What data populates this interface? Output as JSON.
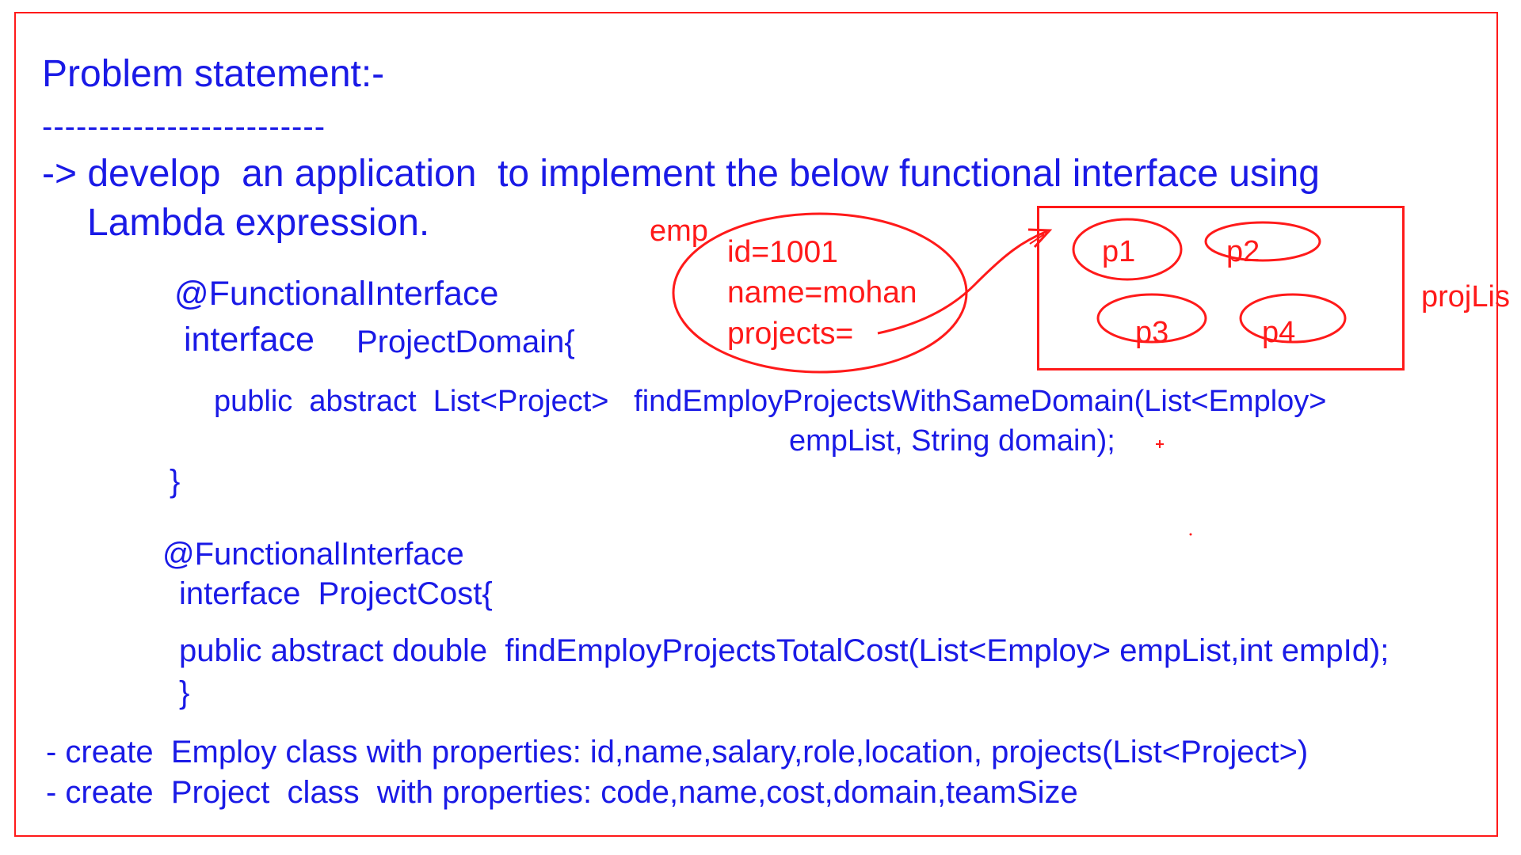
{
  "colors": {
    "text": "#1a1ae6",
    "annotation": "#ff1a1a",
    "background": "#ffffff"
  },
  "heading": {
    "title": "Problem statement:-",
    "underline": "-------------------------"
  },
  "intro": {
    "line1": "-> develop  an application  to implement the below functional interface using",
    "line2": "Lambda expression."
  },
  "interface1": {
    "annotation": "@FunctionalInterface",
    "keyword": "interface",
    "name": "ProjectDomain{",
    "method_line1": "public  abstract  List<Project>   findEmployProjectsWithSameDomain(List<Employ>",
    "method_line2": "empList, String domain);",
    "closing": "}"
  },
  "interface2": {
    "annotation": "@FunctionalInterface",
    "declaration": "interface  ProjectCost{",
    "method": "public abstract double  findEmployProjectsTotalCost(List<Employ> empList,int empId);",
    "closing": "}"
  },
  "requirements": [
    "- create  Employ class with properties: id,name,salary,role,location, projects(List<Project>)",
    "- create  Project  class  with properties: code,name,cost,domain,teamSize"
  ],
  "diagram": {
    "emp_label": "emp",
    "emp_fields": [
      "id=1001",
      "name=mohan",
      "projects="
    ],
    "projects": [
      "p1",
      "p2",
      "p3",
      "p4"
    ],
    "list_label": "projLis"
  }
}
